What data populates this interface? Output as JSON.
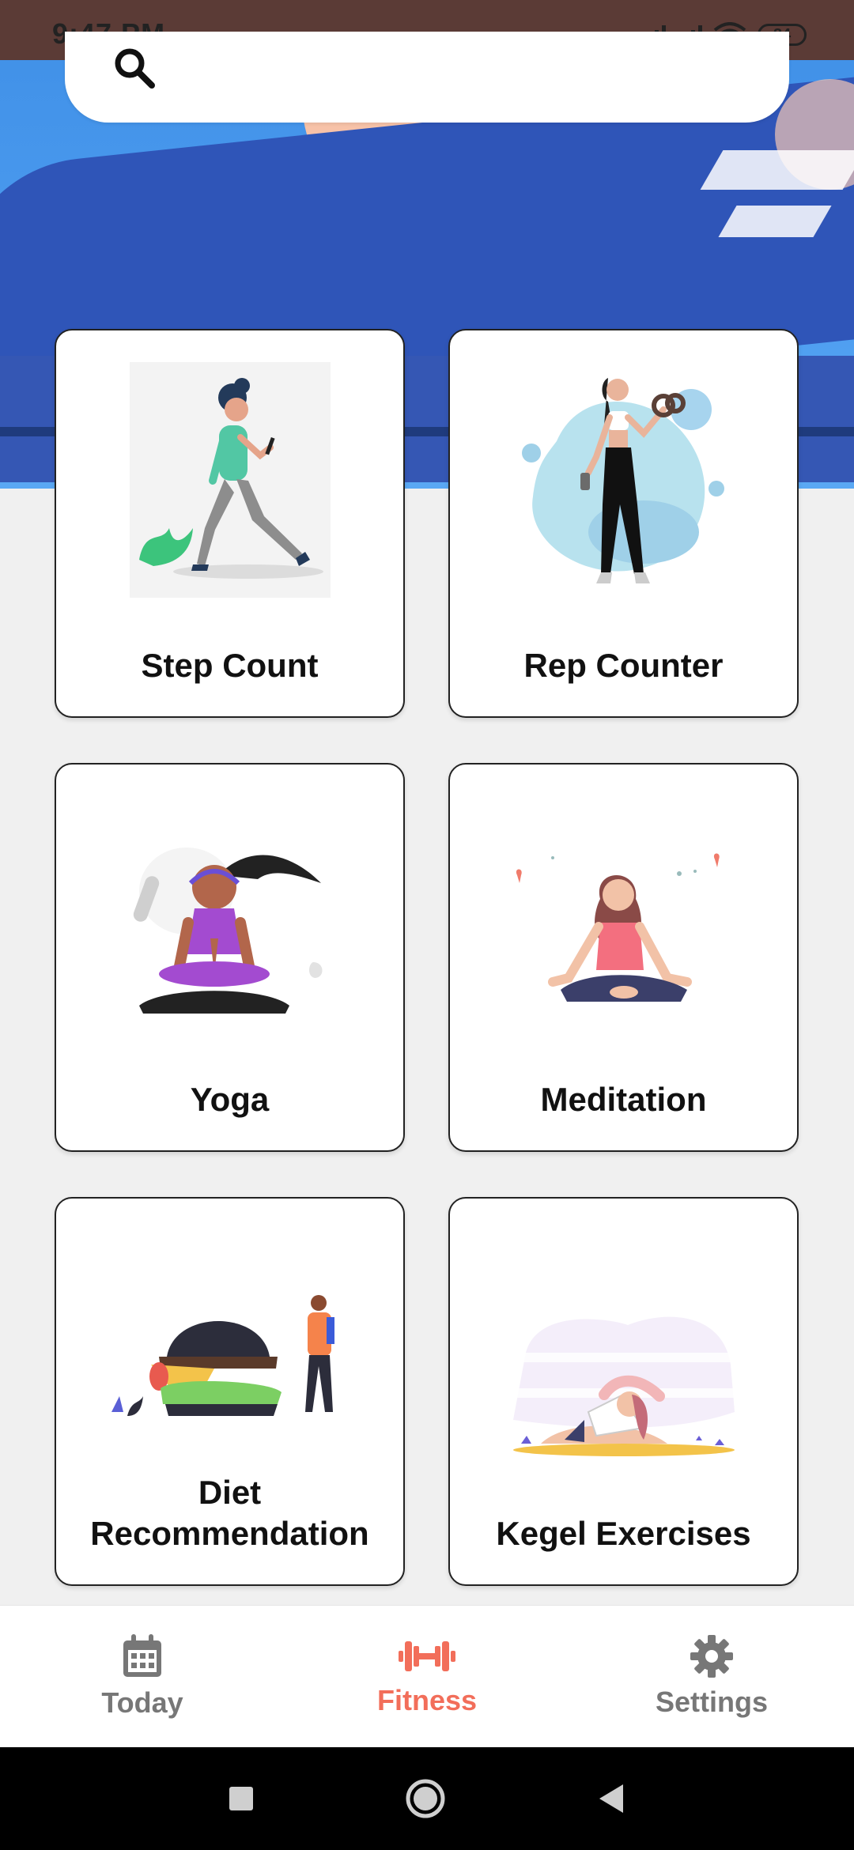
{
  "status_bar": {
    "time": "9:47 PM",
    "battery": "84"
  },
  "search": {
    "placeholder": ""
  },
  "cards": [
    {
      "label": "Step Count",
      "illustration": "walking-person-illustration"
    },
    {
      "label": "Rep Counter",
      "illustration": "dumbbell-woman-illustration"
    },
    {
      "label": "Yoga",
      "illustration": "yoga-woman-illustration"
    },
    {
      "label": "Meditation",
      "illustration": "meditation-woman-illustration"
    },
    {
      "label_line1": "Diet",
      "label_line2": "Recommendation",
      "illustration": "burger-diet-illustration"
    },
    {
      "label": "Kegel Exercises",
      "illustration": "stretching-woman-illustration"
    }
  ],
  "bottom_nav": [
    {
      "label": "Today",
      "icon": "calendar-icon",
      "active": false
    },
    {
      "label": "Fitness",
      "icon": "dumbbell-icon",
      "active": true
    },
    {
      "label": "Settings",
      "icon": "gear-icon",
      "active": false
    }
  ],
  "colors": {
    "accent": "#f26e5a",
    "status_bar": "#5b3b36",
    "hero": "#4c9cf0"
  }
}
